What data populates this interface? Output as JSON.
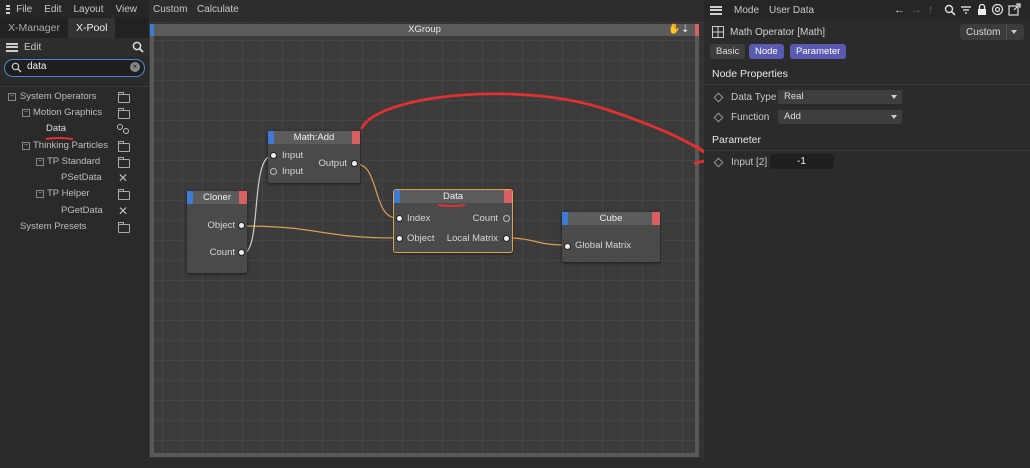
{
  "left_panel": {
    "menu": [
      "File",
      "Edit",
      "Layout",
      "View",
      "Custom",
      "Calculate"
    ],
    "tabs": [
      "X-Manager",
      "X-Pool"
    ],
    "subbar_label": "Edit",
    "search_value": "data",
    "tree": [
      {
        "label": "System Operators"
      },
      {
        "label": "Motion Graphics"
      },
      {
        "label": "Data"
      },
      {
        "label": "Thinking Particles"
      },
      {
        "label": "TP Standard"
      },
      {
        "label": "PSetData"
      },
      {
        "label": "TP Helper"
      },
      {
        "label": "PGetData"
      },
      {
        "label": "System Presets"
      }
    ]
  },
  "canvas": {
    "group_title": "XGroup",
    "nodes": {
      "math_add": {
        "title": "Math:Add",
        "inputs": [
          "Input",
          "Input"
        ],
        "outputs": [
          "Output"
        ]
      },
      "cloner": {
        "title": "Cloner",
        "outputs": [
          "Object",
          "Count"
        ]
      },
      "data": {
        "title": "Data",
        "inputs": [
          "Index",
          "Object"
        ],
        "outputs": [
          "Count",
          "Local Matrix"
        ]
      },
      "cube": {
        "title": "Cube",
        "inputs": [
          "Global Matrix"
        ]
      }
    }
  },
  "right_panel": {
    "menu": [
      "Mode",
      "User Data"
    ],
    "object_title": "Math Operator [Math]",
    "layout_value": "Custom",
    "tabs": [
      "Basic",
      "Node",
      "Parameter"
    ],
    "section_node": "Node Properties",
    "data_type_label": "Data Type",
    "data_type_value": "Real",
    "function_label": "Function",
    "function_value": "Add",
    "section_param": "Parameter",
    "input_label": "Input [2]",
    "input_value": "-1"
  },
  "colors": {
    "accent_blue": "#3d7bd4",
    "accent_red": "#d96060",
    "annotation_red": "#e03030",
    "wire": "#d9a050",
    "tab_active": "#5a5ab0"
  }
}
